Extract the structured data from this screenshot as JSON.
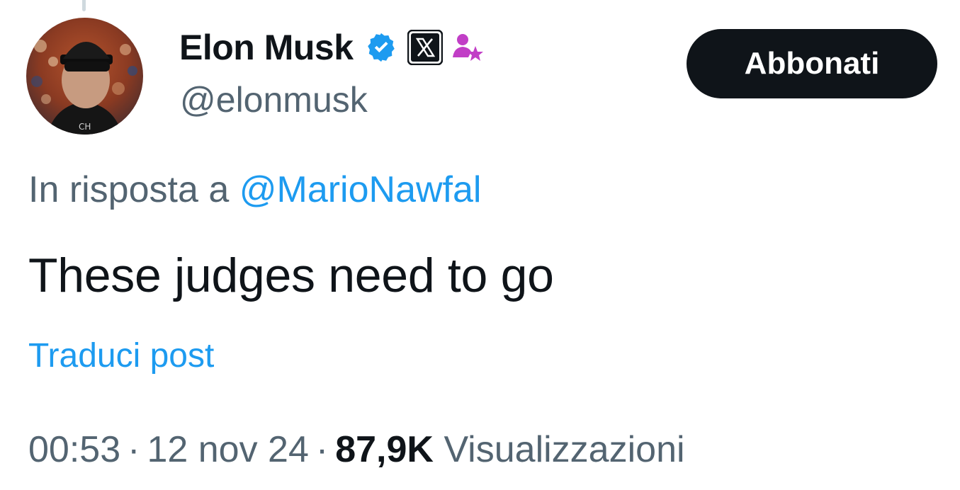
{
  "author": {
    "display_name": "Elon Musk",
    "handle": "@elonmusk",
    "avatar_icon": "profile-photo",
    "badges": [
      "verified-badge-icon",
      "x-logo-icon",
      "affiliate-star-icon"
    ],
    "verified_color": "#1d9bf0",
    "affiliate_color": "#c13ec6"
  },
  "subscribe_button": {
    "label": "Abbonati"
  },
  "reply": {
    "prefix": "In risposta a",
    "mention": "@MarioNawfal"
  },
  "post": {
    "text": "These judges need to go",
    "translate_label": "Traduci post"
  },
  "meta": {
    "time": "00:53",
    "separator": "·",
    "date": "12 nov 24",
    "views_count": "87,9K",
    "views_label": "Visualizzazioni"
  },
  "colors": {
    "text_primary": "#0f1419",
    "text_secondary": "#536471",
    "link": "#1d9bf0",
    "button_bg": "#0f1419",
    "button_text": "#ffffff"
  }
}
